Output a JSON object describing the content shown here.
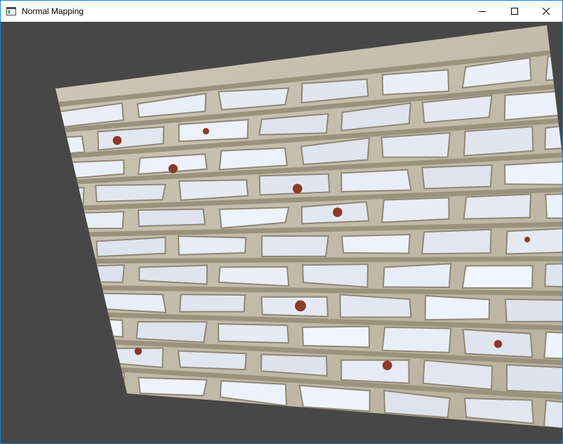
{
  "window": {
    "title": "Normal Mapping",
    "icon": "application-window-icon",
    "controls": [
      "minimize",
      "maximize",
      "close"
    ]
  },
  "scene": {
    "description_label": "",
    "background_color": "#474747",
    "surface_texture": "brick-wall-normal-mapped"
  }
}
